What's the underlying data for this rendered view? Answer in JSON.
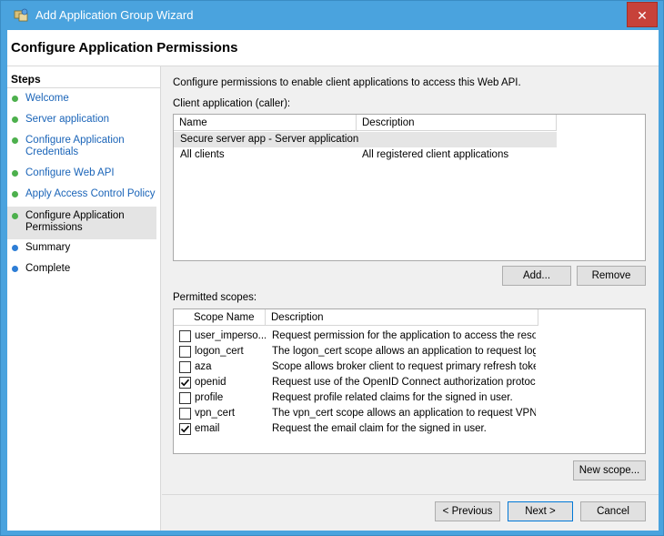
{
  "window": {
    "title": "Add Application Group Wizard",
    "close_glyph": "✕"
  },
  "header": {
    "title": "Configure Application Permissions"
  },
  "steps": {
    "title": "Steps",
    "items": [
      {
        "label": "Welcome"
      },
      {
        "label": "Server application"
      },
      {
        "label": "Configure Application Credentials"
      },
      {
        "label": "Configure Web API"
      },
      {
        "label": "Apply Access Control Policy"
      },
      {
        "label": "Configure Application Permissions"
      },
      {
        "label": "Summary"
      },
      {
        "label": "Complete"
      }
    ]
  },
  "main": {
    "intro": "Configure permissions to enable client applications to access this Web API.",
    "client_label": "Client application (caller):",
    "client_table": {
      "headers": [
        "Name",
        "Description"
      ],
      "rows": [
        [
          "Secure server app - Server application",
          ""
        ],
        [
          "All clients",
          "All registered client applications"
        ]
      ]
    },
    "add_button": "Add...",
    "remove_button": "Remove",
    "scopes_label": "Permitted scopes:",
    "scopes_table": {
      "headers": [
        "Scope Name",
        "Description"
      ],
      "rows": [
        {
          "name": "user_imperso...",
          "desc": "Request permission for the application to access the resour...",
          "checked": false
        },
        {
          "name": "logon_cert",
          "desc": "The logon_cert scope allows an application to request logo...",
          "checked": false
        },
        {
          "name": "aza",
          "desc": "Scope allows broker client to request primary refresh token.",
          "checked": false
        },
        {
          "name": "openid",
          "desc": "Request use of the OpenID Connect authorization protocol.",
          "checked": true
        },
        {
          "name": "profile",
          "desc": "Request profile related claims for the signed in user.",
          "checked": false
        },
        {
          "name": "vpn_cert",
          "desc": "The vpn_cert scope allows an application to request VPN ...",
          "checked": false
        },
        {
          "name": "email",
          "desc": "Request the email claim for the signed in user.",
          "checked": true
        }
      ]
    },
    "new_scope_button": "New scope...",
    "previous_button": "< Previous",
    "next_button": "Next >",
    "cancel_button": "Cancel"
  }
}
